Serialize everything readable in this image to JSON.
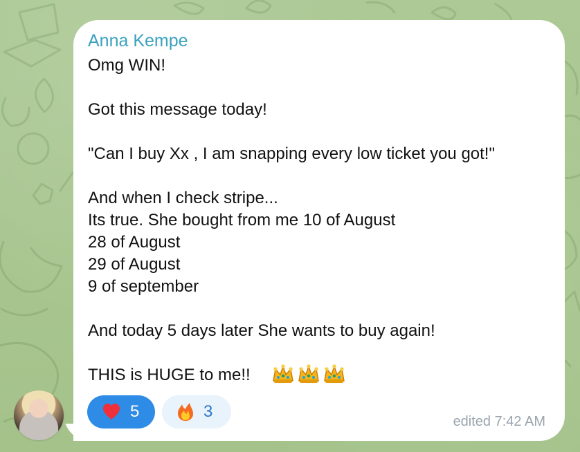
{
  "chat_message": {
    "sender_name": "Anna Kempe",
    "lines": [
      "Omg WIN!",
      "",
      "Got this message today!",
      "",
      "\"Can I buy Xx , I am snapping every low ticket you got!\"",
      "",
      "And when I check stripe...",
      "Its true. She bought from me 10 of August",
      "28 of August",
      "29 of August",
      "9 of september",
      "",
      "And today 5 days later She wants to buy again!",
      "",
      "THIS is HUGE to me!! "
    ],
    "crown_emoji_count": 3,
    "reactions": [
      {
        "emoji": "heart-icon",
        "count": "5",
        "active": true
      },
      {
        "emoji": "fire-icon",
        "count": "3",
        "active": false
      }
    ],
    "status": "edited 7:42 AM"
  },
  "colors": {
    "background": "#a9c68f",
    "bubble": "#ffffff",
    "sender": "#3aa1bf",
    "active_reaction": "#2e8be6",
    "inactive_reaction": "#e8f3fb",
    "meta": "#9aa4ad"
  }
}
